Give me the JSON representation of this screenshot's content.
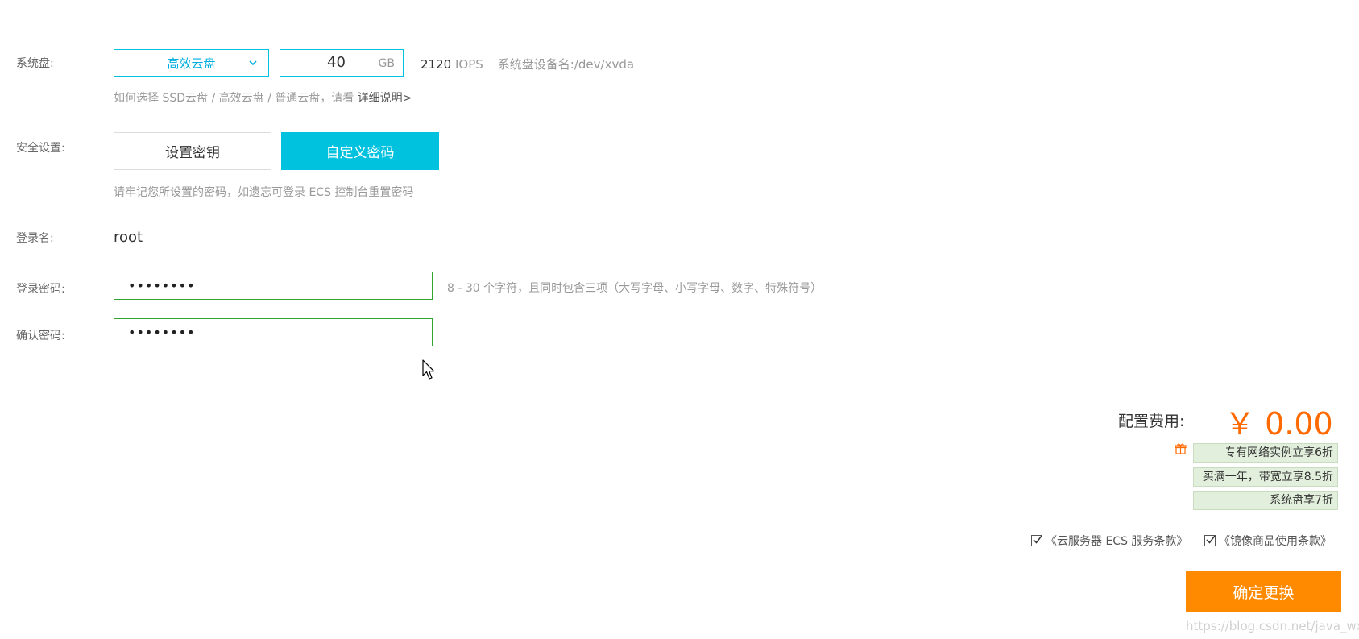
{
  "system_disk": {
    "label": "系统盘:",
    "type_selected": "高效云盘",
    "size_value": "40",
    "size_unit": "GB",
    "iops_value": "2120",
    "iops_unit": "IOPS",
    "device_label": "系统盘设备名:",
    "device_name": "/dev/xvda",
    "hint": "如何选择 SSD云盘 / 高效云盘 / 普通云盘，请看 ",
    "hint_link": "详细说明>"
  },
  "security": {
    "label": "安全设置:",
    "set_key_label": "设置密钥",
    "custom_password_label": "自定义密码",
    "hint": "请牢记您所设置的密码，如遗忘可登录 ECS 控制台重置密码"
  },
  "login_name": {
    "label": "登录名:",
    "value": "root"
  },
  "login_password": {
    "label": "登录密码:",
    "value": "••••••••",
    "hint": "8 - 30 个字符，且同时包含三项（大写字母、小写字母、数字、特殊符号）"
  },
  "confirm_password": {
    "label": "确认密码:",
    "value": "••••••••"
  },
  "cost": {
    "label": "配置费用:",
    "value": "￥ 0.00"
  },
  "promotions": [
    "专有网络实例立享6折",
    "买满一年，带宽立享8.5折",
    "系统盘享7折"
  ],
  "terms": {
    "ecs_terms": "《云服务器 ECS 服务条款》",
    "image_terms": "《镜像商品使用条款》"
  },
  "confirm_button_label": "确定更换",
  "watermark": "https://blog.csdn.net/java_wxid",
  "colors": {
    "accent": "#00c1de",
    "price": "#ff6a00",
    "confirm_button": "#ff8a00",
    "valid_border": "#2fa52f",
    "promo_bg": "#e2efdc"
  }
}
